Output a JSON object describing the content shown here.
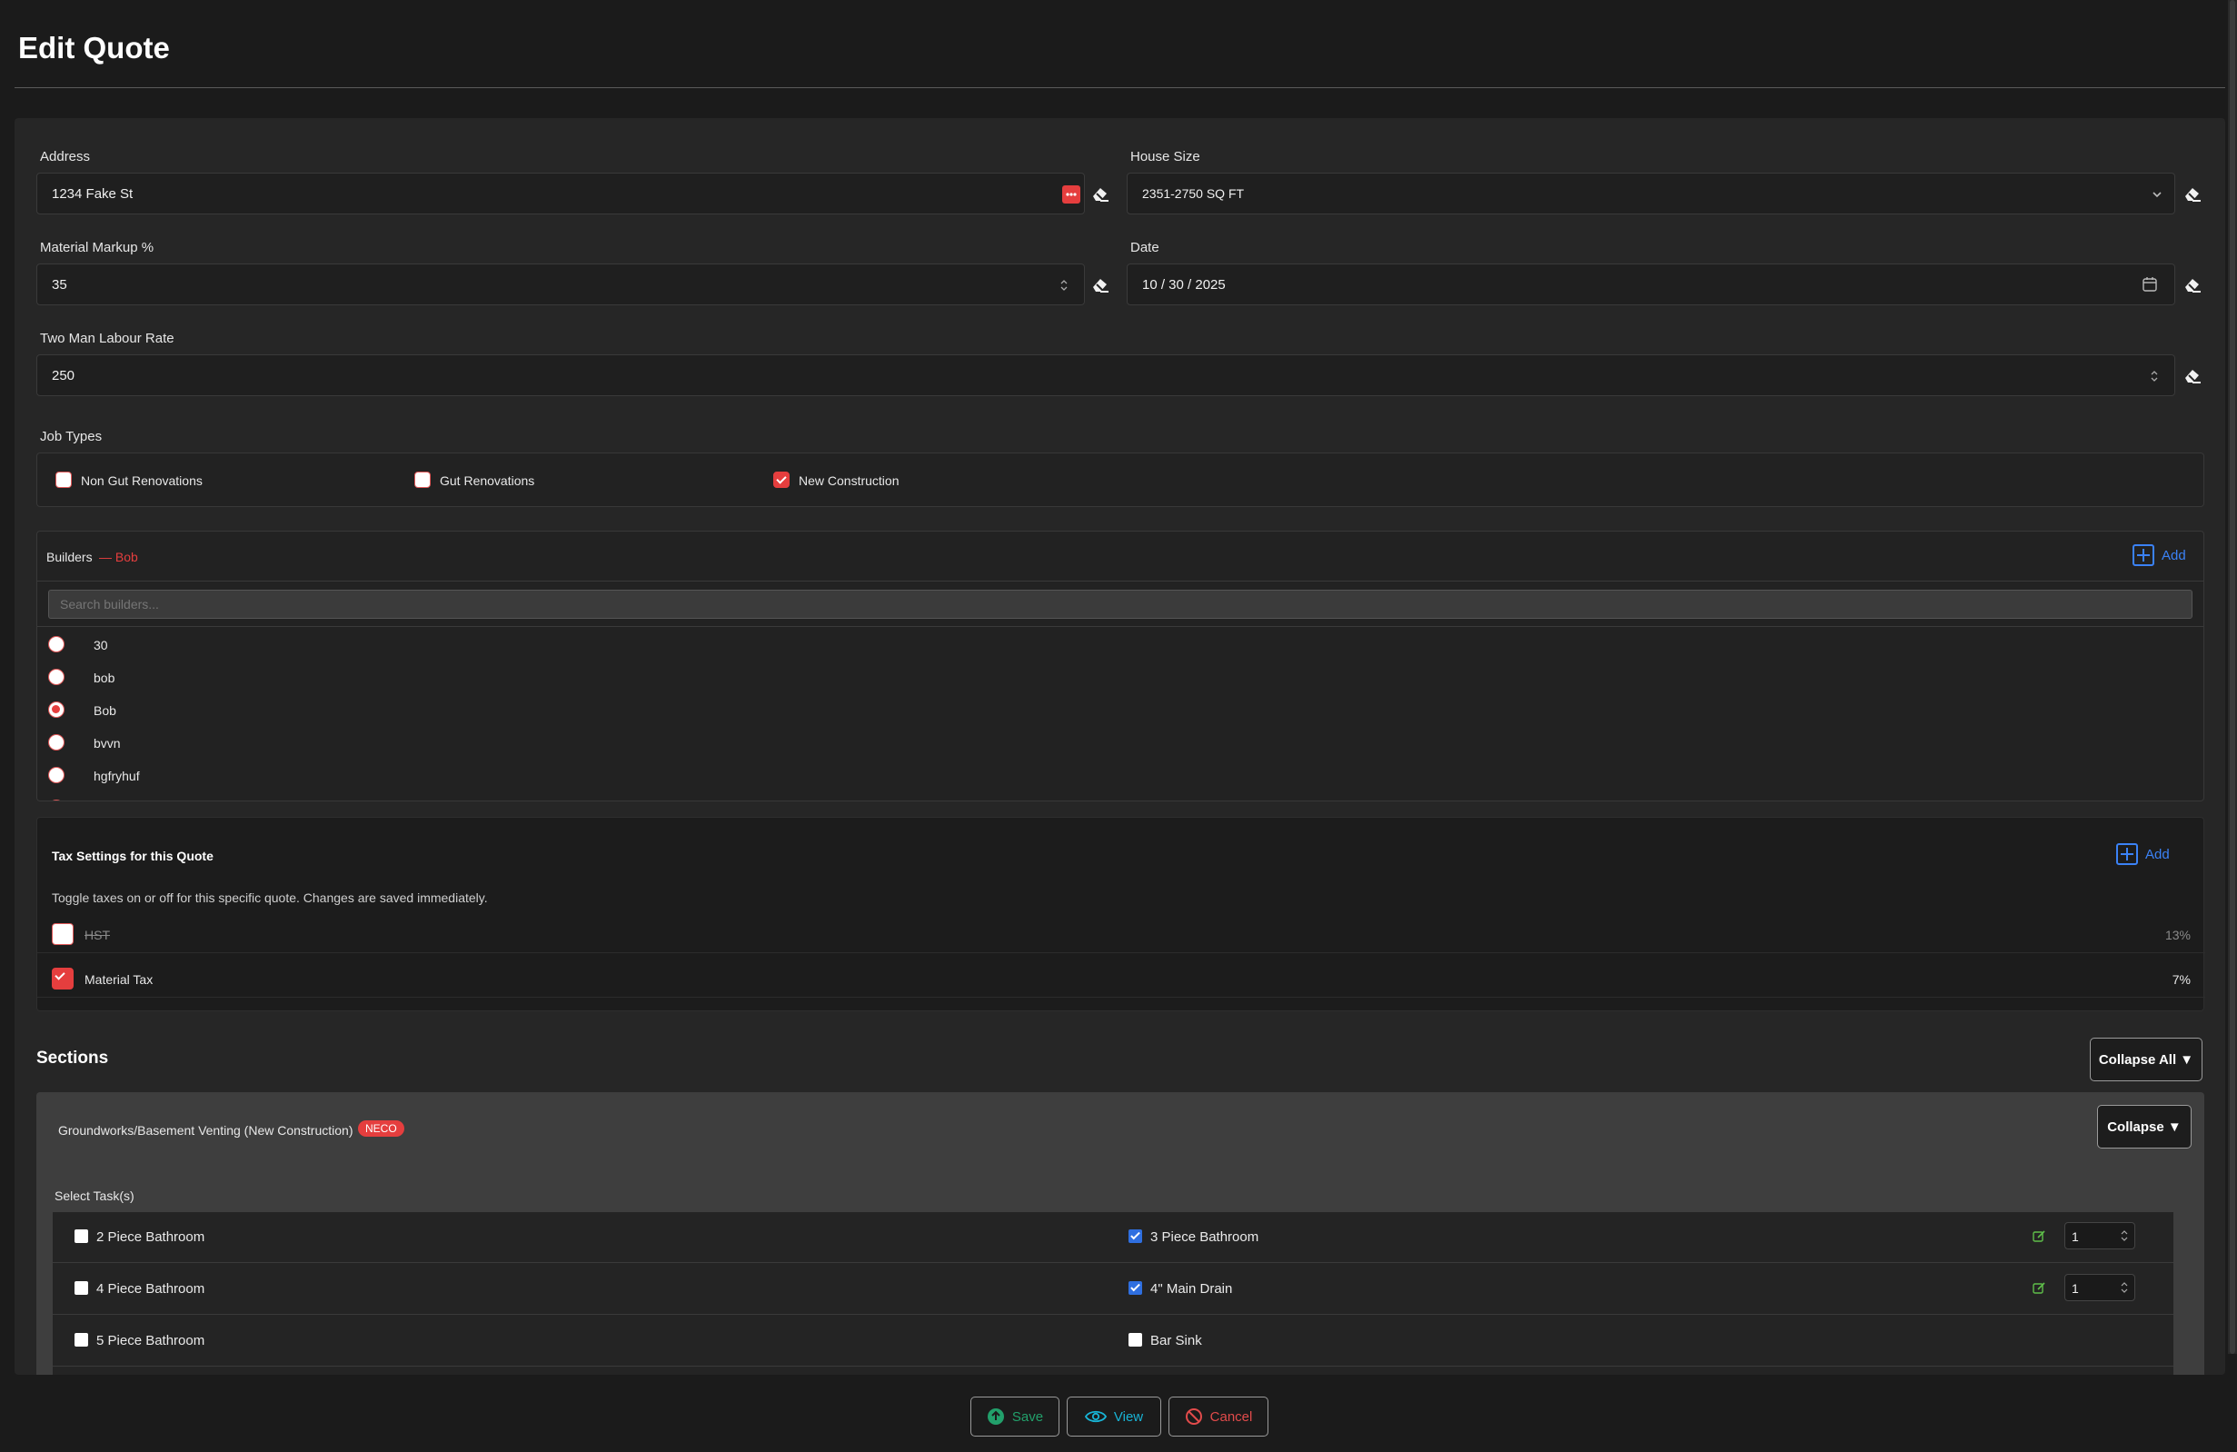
{
  "page": {
    "title": "Edit Quote"
  },
  "address": {
    "label": "Address",
    "value": "1234 Fake St"
  },
  "house_size": {
    "label": "House Size",
    "value": "2351-2750 SQ FT"
  },
  "markup": {
    "label": "Material Markup %",
    "value": "35"
  },
  "date": {
    "label": "Date",
    "value": "10 / 30 / 2025"
  },
  "labour": {
    "label": "Two Man Labour Rate",
    "value": "250"
  },
  "job_types": {
    "label": "Job Types",
    "items": [
      {
        "label": "Non Gut Renovations",
        "checked": false
      },
      {
        "label": "Gut Renovations",
        "checked": false
      },
      {
        "label": "New Construction",
        "checked": true
      }
    ]
  },
  "builders": {
    "label": "Builders",
    "selected": "— Bob",
    "add_label": "Add",
    "search_placeholder": "Search builders...",
    "items": [
      {
        "label": "30",
        "selected": false
      },
      {
        "label": "bob",
        "selected": false
      },
      {
        "label": "Bob",
        "selected": true
      },
      {
        "label": "bvvn",
        "selected": false
      },
      {
        "label": "hgfryhuf",
        "selected": false
      }
    ]
  },
  "tax": {
    "title": "Tax Settings for this Quote",
    "add_label": "Add",
    "description": "Toggle taxes on or off for this specific quote. Changes are saved immediately.",
    "items": [
      {
        "label": "HST",
        "rate": "13%",
        "enabled": false
      },
      {
        "label": "Material Tax",
        "rate": "7%",
        "enabled": true
      }
    ]
  },
  "sections": {
    "title": "Sections",
    "collapse_all_label": "Collapse All ▼",
    "section": {
      "name": "Groundworks/Basement Venting (New Construction)",
      "badge": "NECO",
      "collapse_label": "Collapse ▼",
      "select_tasks_label": "Select Task(s)",
      "tasks": [
        {
          "left": "2 Piece Bathroom",
          "left_checked": false,
          "right": "3 Piece Bathroom",
          "right_checked": true,
          "qty": "1"
        },
        {
          "left": "4 Piece Bathroom",
          "left_checked": false,
          "right": "4\" Main Drain",
          "right_checked": true,
          "qty": "1"
        },
        {
          "left": "5 Piece Bathroom",
          "left_checked": false,
          "right": "Bar Sink",
          "right_checked": false
        }
      ]
    }
  },
  "footer": {
    "save_label": "Save",
    "view_label": "View",
    "cancel_label": "Cancel"
  },
  "colors": {
    "accent_red": "#e53e3e",
    "accent_blue": "#3b82f6",
    "save_green": "#22a06b",
    "view_teal": "#18b4d6",
    "cancel_red": "#e24b4b",
    "background": "#1b1b1b"
  }
}
